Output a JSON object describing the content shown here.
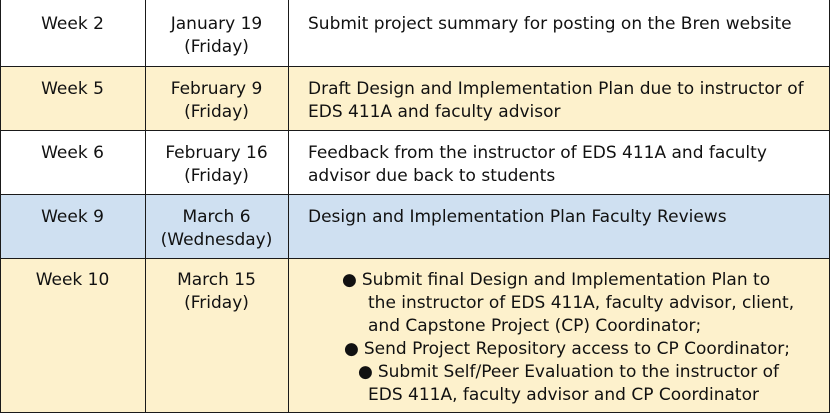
{
  "rows": [
    {
      "week": "Week 2",
      "date": "January 19",
      "day": "(Friday)",
      "lines": [
        "Submit project summary for posting on the Bren website"
      ]
    },
    {
      "week": "Week 5",
      "date": "February 9",
      "day": "(Friday)",
      "lines": [
        "Draft Design and Implementation Plan due to instructor of",
        "EDS 411A and faculty advisor"
      ]
    },
    {
      "week": "Week 6",
      "date": "February 16",
      "day": "(Friday)",
      "lines": [
        "Feedback from the instructor of EDS 411A and faculty",
        "advisor due back to students"
      ]
    },
    {
      "week": "Week 9",
      "date": "March 6",
      "day": "(Wednesday)",
      "lines": [
        "Design and Implementation Plan Faculty Reviews"
      ]
    },
    {
      "week": "Week 10",
      "date": "March 15",
      "day": "(Friday)",
      "bullets": [
        {
          "bullet": "●",
          "lines": [
            "Submit final Design and Implementation Plan to",
            "the instructor of EDS 411A, faculty advisor, client,",
            "and Capstone Project (CP) Coordinator;"
          ]
        },
        {
          "bullet": "●",
          "lines": [
            "Send Project Repository access to CP Coordinator;"
          ]
        },
        {
          "bullet": "●",
          "lines": [
            "Submit Self/Peer Evaluation to the instructor of",
            "EDS 411A, faculty advisor and CP Coordinator"
          ]
        }
      ]
    }
  ]
}
